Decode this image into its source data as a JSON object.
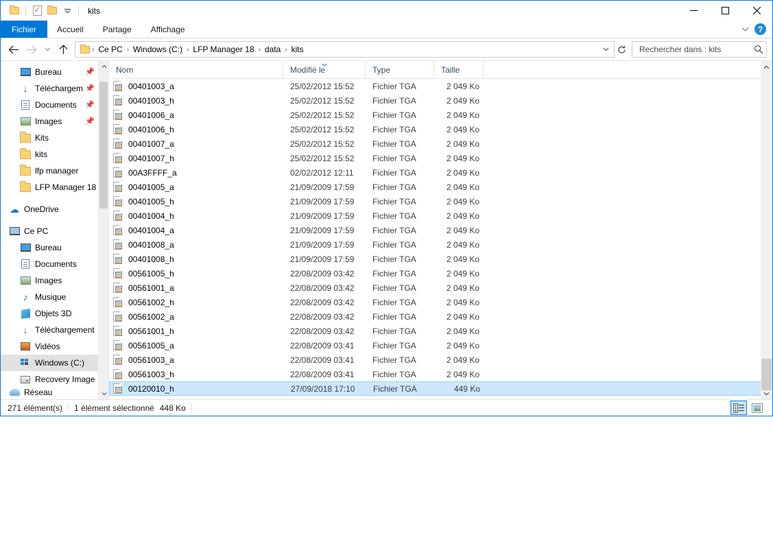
{
  "window": {
    "title": "kits",
    "quick_access": [
      {
        "name": "folder-icon",
        "label": "Folder"
      },
      {
        "name": "properties-icon",
        "label": "Propriétés"
      },
      {
        "name": "new-folder-icon",
        "label": "Nouveau dossier"
      }
    ],
    "controls": {
      "minimize": "—",
      "maximize": "□",
      "close": "✕"
    }
  },
  "ribbon": {
    "tabs": [
      {
        "label": "Fichier",
        "active": true
      },
      {
        "label": "Accueil",
        "active": false
      },
      {
        "label": "Partage",
        "active": false
      },
      {
        "label": "Affichage",
        "active": false
      }
    ],
    "expand_label": "⌄",
    "help_label": "?"
  },
  "address": {
    "back": "←",
    "forward": "→",
    "recent": "⌄",
    "up": "↑",
    "breadcrumbs": [
      "Ce PC",
      "Windows (C:)",
      "LFP Manager 18",
      "data",
      "kits"
    ],
    "separator": "›",
    "dropdown": "⌄",
    "refresh": "↻"
  },
  "search": {
    "placeholder": "Rechercher dans : kits",
    "value": "",
    "icon": "search-icon"
  },
  "sidebar": {
    "items": [
      {
        "label": "Bureau",
        "icon": "monitor-icon",
        "level": 1,
        "pinned": true,
        "selected": false
      },
      {
        "label": "Téléchargem",
        "icon": "download-icon",
        "level": 1,
        "pinned": true,
        "selected": false
      },
      {
        "label": "Documents",
        "icon": "document-icon",
        "level": 1,
        "pinned": true,
        "selected": false
      },
      {
        "label": "Images",
        "icon": "pictures-icon",
        "level": 1,
        "pinned": true,
        "selected": false
      },
      {
        "label": "Kits",
        "icon": "folder-icon",
        "level": 1,
        "pinned": false,
        "selected": false
      },
      {
        "label": "kits",
        "icon": "folder-icon",
        "level": 1,
        "pinned": false,
        "selected": false
      },
      {
        "label": "lfp manager",
        "icon": "folder-icon",
        "level": 1,
        "pinned": false,
        "selected": false
      },
      {
        "label": "LFP Manager 18",
        "icon": "folder-icon",
        "level": 1,
        "pinned": false,
        "selected": false
      },
      {
        "label": "OneDrive",
        "icon": "cloud-icon",
        "level": 0,
        "pinned": false,
        "selected": false
      },
      {
        "label": "Ce PC",
        "icon": "pc-icon",
        "level": 0,
        "pinned": false,
        "selected": false
      },
      {
        "label": "Bureau",
        "icon": "monitor-icon",
        "level": 1,
        "pinned": false,
        "selected": false
      },
      {
        "label": "Documents",
        "icon": "document-icon",
        "level": 1,
        "pinned": false,
        "selected": false
      },
      {
        "label": "Images",
        "icon": "pictures-icon",
        "level": 1,
        "pinned": false,
        "selected": false
      },
      {
        "label": "Musique",
        "icon": "music-icon",
        "level": 1,
        "pinned": false,
        "selected": false
      },
      {
        "label": "Objets 3D",
        "icon": "objects3d-icon",
        "level": 1,
        "pinned": false,
        "selected": false
      },
      {
        "label": "Téléchargement",
        "icon": "download-icon",
        "level": 1,
        "pinned": false,
        "selected": false
      },
      {
        "label": "Vidéos",
        "icon": "video-icon",
        "level": 1,
        "pinned": false,
        "selected": false
      },
      {
        "label": "Windows (C:)",
        "icon": "windows-drive-icon",
        "level": 1,
        "pinned": false,
        "selected": true
      },
      {
        "label": "Recovery Image",
        "icon": "drive-icon",
        "level": 1,
        "pinned": false,
        "selected": false
      },
      {
        "label": "Réseau",
        "icon": "network-icon",
        "level": 0,
        "pinned": false,
        "selected": false
      }
    ],
    "scroll_up": "⌃",
    "scroll_down": "⌄"
  },
  "filelist": {
    "columns": [
      {
        "label": "Nom",
        "key": "name",
        "sorted": false
      },
      {
        "label": "Modifié le",
        "key": "date",
        "sorted": true
      },
      {
        "label": "Type",
        "key": "type",
        "sorted": false
      },
      {
        "label": "Taille",
        "key": "size",
        "sorted": false
      }
    ],
    "sort_mark": "⌄",
    "rows": [
      {
        "name": "00401003_a",
        "date": "25/02/2012 15:52",
        "type": "Fichier TGA",
        "size": "2 049 Ko",
        "selected": false
      },
      {
        "name": "00401003_h",
        "date": "25/02/2012 15:52",
        "type": "Fichier TGA",
        "size": "2 049 Ko",
        "selected": false
      },
      {
        "name": "00401006_a",
        "date": "25/02/2012 15:52",
        "type": "Fichier TGA",
        "size": "2 049 Ko",
        "selected": false
      },
      {
        "name": "00401006_h",
        "date": "25/02/2012 15:52",
        "type": "Fichier TGA",
        "size": "2 049 Ko",
        "selected": false
      },
      {
        "name": "00401007_a",
        "date": "25/02/2012 15:52",
        "type": "Fichier TGA",
        "size": "2 049 Ko",
        "selected": false
      },
      {
        "name": "00401007_h",
        "date": "25/02/2012 15:52",
        "type": "Fichier TGA",
        "size": "2 049 Ko",
        "selected": false
      },
      {
        "name": "00A3FFFF_a",
        "date": "02/02/2012 12:11",
        "type": "Fichier TGA",
        "size": "2 049 Ko",
        "selected": false
      },
      {
        "name": "00401005_a",
        "date": "21/09/2009 17:59",
        "type": "Fichier TGA",
        "size": "2 049 Ko",
        "selected": false
      },
      {
        "name": "00401005_h",
        "date": "21/09/2009 17:59",
        "type": "Fichier TGA",
        "size": "2 049 Ko",
        "selected": false
      },
      {
        "name": "00401004_h",
        "date": "21/09/2009 17:59",
        "type": "Fichier TGA",
        "size": "2 049 Ko",
        "selected": false
      },
      {
        "name": "00401004_a",
        "date": "21/09/2009 17:59",
        "type": "Fichier TGA",
        "size": "2 049 Ko",
        "selected": false
      },
      {
        "name": "00401008_a",
        "date": "21/09/2009 17:59",
        "type": "Fichier TGA",
        "size": "2 049 Ko",
        "selected": false
      },
      {
        "name": "00401008_h",
        "date": "21/09/2009 17:59",
        "type": "Fichier TGA",
        "size": "2 049 Ko",
        "selected": false
      },
      {
        "name": "00561005_h",
        "date": "22/08/2009 03:42",
        "type": "Fichier TGA",
        "size": "2 049 Ko",
        "selected": false
      },
      {
        "name": "00561001_a",
        "date": "22/08/2009 03:42",
        "type": "Fichier TGA",
        "size": "2 049 Ko",
        "selected": false
      },
      {
        "name": "00561002_h",
        "date": "22/08/2009 03:42",
        "type": "Fichier TGA",
        "size": "2 049 Ko",
        "selected": false
      },
      {
        "name": "00561002_a",
        "date": "22/08/2009 03:42",
        "type": "Fichier TGA",
        "size": "2 049 Ko",
        "selected": false
      },
      {
        "name": "00561001_h",
        "date": "22/08/2009 03:42",
        "type": "Fichier TGA",
        "size": "2 049 Ko",
        "selected": false
      },
      {
        "name": "00561005_a",
        "date": "22/08/2009 03:41",
        "type": "Fichier TGA",
        "size": "2 049 Ko",
        "selected": false
      },
      {
        "name": "00561003_a",
        "date": "22/08/2009 03:41",
        "type": "Fichier TGA",
        "size": "2 049 Ko",
        "selected": false
      },
      {
        "name": "00561003_h",
        "date": "22/08/2009 03:41",
        "type": "Fichier TGA",
        "size": "2 049 Ko",
        "selected": false
      },
      {
        "name": "00120010_h",
        "date": "27/09/2018 17:10",
        "type": "Fichier TGA",
        "size": "449 Ko",
        "selected": true
      }
    ],
    "scroll_up": "⌃",
    "scroll_down": "⌄"
  },
  "statusbar": {
    "item_count": "271 élément(s)",
    "selection": "1 élément sélectionné",
    "selection_size": "448 Ko",
    "views": [
      {
        "name": "details-view",
        "active": true
      },
      {
        "name": "large-icons-view",
        "active": false
      }
    ]
  },
  "colors": {
    "accent": "#0078d7",
    "selection": "#cce8ff",
    "header_text": "#33506b"
  }
}
